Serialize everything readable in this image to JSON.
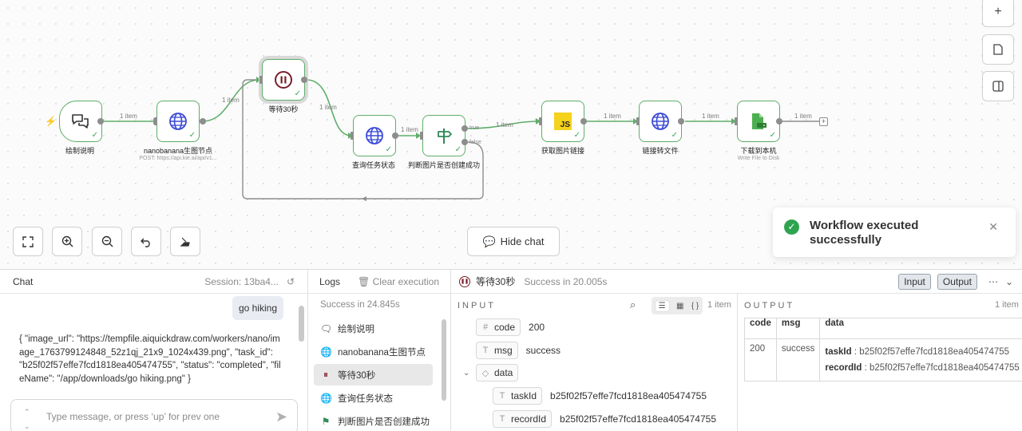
{
  "nodes": [
    {
      "name": "绘制说明",
      "icon": "chat-icon",
      "sub": ""
    },
    {
      "name": "nanobanana生图节点",
      "icon": "globe-icon",
      "sub": "POST: https://api.kie.ai/api/v1..."
    },
    {
      "name": "等待30秒",
      "icon": "pause-icon",
      "sub": ""
    },
    {
      "name": "查询任务状态",
      "icon": "globe-icon",
      "sub": ""
    },
    {
      "name": "判断图片是否创建成功",
      "icon": "signpost-icon",
      "sub": ""
    },
    {
      "name": "获取图片链接",
      "icon": "js-icon",
      "sub": ""
    },
    {
      "name": "链接转文件",
      "icon": "globe-icon",
      "sub": ""
    },
    {
      "name": "下载到本机",
      "icon": "file-icon",
      "sub": "Write File to Disk"
    }
  ],
  "connections": {
    "label": "1 item",
    "true_label": "true",
    "false_label": "false"
  },
  "canvas": {
    "js_glyph": "JS",
    "hide_chat": "Hide chat"
  },
  "toast": {
    "message": "Workflow executed successfully"
  },
  "chat": {
    "title": "Chat",
    "session": "Session: 13ba4...",
    "user_message": "go hiking",
    "reply": "{ \"image_url\": \"https://tempfile.aiquickdraw.com/workers/nano/image_1763799124848_52z1qj_21x9_1024x439.png\", \"task_id\": \"b25f02f57effe7fcd1818ea405474755\", \"status\": \"completed\", \"fileName\": \"/app/downloads/go hiking.png\" }",
    "input_placeholder": "Type message, or press ‘up’ for prev one"
  },
  "logs": {
    "title": "Logs",
    "clear": "Clear execution",
    "summary": "Success in 24.845s",
    "items": [
      {
        "label": "绘制说明",
        "icon": "chat-icon"
      },
      {
        "label": "nanobanana生图节点",
        "icon": "globe-icon"
      },
      {
        "label": "等待30秒",
        "icon": "pause-icon",
        "active": true
      },
      {
        "label": "查询任务状态",
        "icon": "globe-icon"
      },
      {
        "label": "判断图片是否创建成功",
        "icon": "signpost-icon"
      }
    ]
  },
  "io": {
    "node_name": "等待30秒",
    "status": "Success in 20.005s",
    "input_tab": "Input",
    "output_tab": "Output",
    "input_title": "INPUT",
    "output_title": "OUTPUT",
    "input_count": "1 item",
    "output_count": "1 item",
    "input_fields": [
      {
        "key": "code",
        "type": "#",
        "value": "200"
      },
      {
        "key": "msg",
        "type": "T",
        "value": "success"
      },
      {
        "key": "data",
        "type": "◇",
        "value": ""
      },
      {
        "key": "taskId",
        "type": "T",
        "value": "b25f02f57effe7fcd1818ea405474755"
      },
      {
        "key": "recordId",
        "type": "T",
        "value": "b25f02f57effe7fcd1818ea405474755"
      }
    ],
    "output_headers": [
      "code",
      "msg",
      "data"
    ],
    "output_row": {
      "code": "200",
      "msg": "success",
      "data_taskId_key": "taskId",
      "data_taskId": "b25f02f57effe7fcd1818ea405474755",
      "data_recordId_key": "recordId",
      "data_recordId": "b25f02f57effe7fcd1818ea405474755"
    }
  },
  "colors": {
    "node_border": "#5fae6a",
    "success": "#2ea44f",
    "pause": "#7b1d2a",
    "globe": "#3b4bd8",
    "js_bg": "#f5d21c"
  }
}
